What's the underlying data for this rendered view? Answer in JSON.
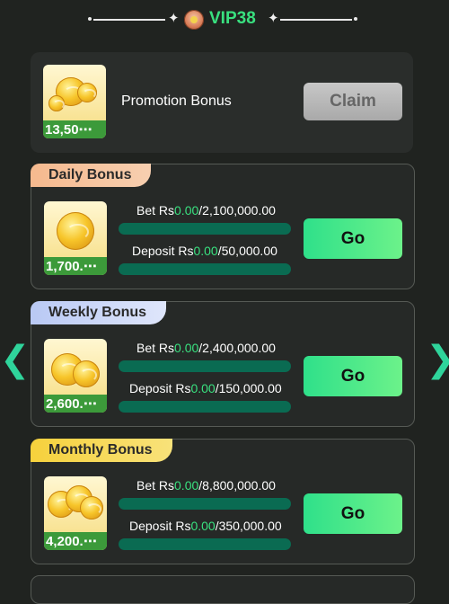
{
  "header": {
    "vip_label": "VIP38"
  },
  "promotion": {
    "title": "Promotion Bonus",
    "amount": "13,50⋯",
    "claim_label": "Claim"
  },
  "bonuses": {
    "daily": {
      "tag": "Daily Bonus",
      "amount": "1,700.⋯",
      "bet_prefix": "Bet Rs",
      "bet_current": "0.00",
      "bet_total": "/2,100,000.00",
      "bet_progress": 0,
      "deposit_prefix": "Deposit Rs",
      "deposit_current": "0.00",
      "deposit_total": "/50,000.00",
      "deposit_progress": 0,
      "go_label": "Go"
    },
    "weekly": {
      "tag": "Weekly Bonus",
      "amount": "2,600.⋯",
      "bet_prefix": "Bet Rs",
      "bet_current": "0.00",
      "bet_total": "/2,400,000.00",
      "bet_progress": 0,
      "deposit_prefix": "Deposit Rs",
      "deposit_current": "0.00",
      "deposit_total": "/150,000.00",
      "deposit_progress": 0,
      "go_label": "Go"
    },
    "monthly": {
      "tag": "Monthly Bonus",
      "amount": "4,200.⋯",
      "bet_prefix": "Bet Rs",
      "bet_current": "0.00",
      "bet_total": "/8,800,000.00",
      "bet_progress": 0,
      "deposit_prefix": "Deposit Rs",
      "deposit_current": "0.00",
      "deposit_total": "/350,000.00",
      "deposit_progress": 0,
      "go_label": "Go"
    }
  },
  "nav": {
    "prev_glyph": "❮",
    "next_glyph": "❯"
  },
  "colors": {
    "accent": "#39e07f",
    "background": "#202320",
    "card": "#2a2d2b",
    "progress_track": "#0a6b52"
  }
}
